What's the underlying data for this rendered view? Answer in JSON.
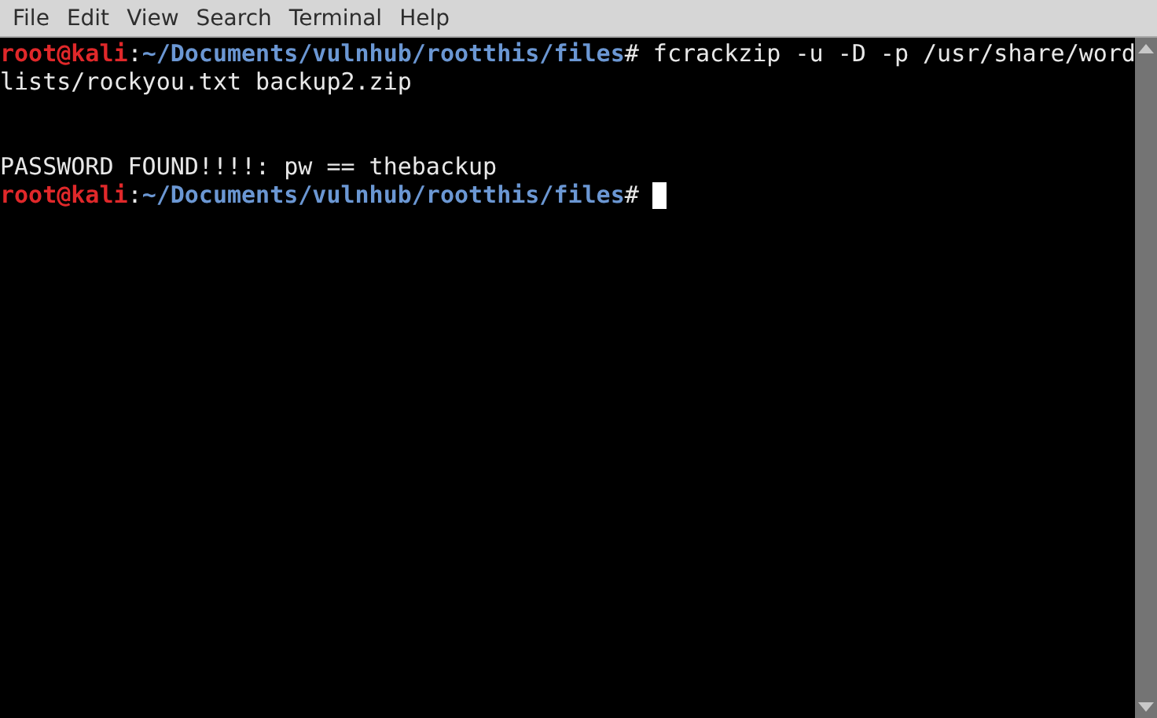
{
  "menu_bar": {
    "items": [
      "File",
      "Edit",
      "View",
      "Search",
      "Terminal",
      "Help"
    ]
  },
  "terminal": {
    "lines": [
      {
        "kind": "text",
        "segments": [
          {
            "kind": "user",
            "text": "root@kali"
          },
          {
            "kind": "plain",
            "text": ":"
          },
          {
            "kind": "path",
            "text": "~/Documents/vulnhub/rootthis/files"
          },
          {
            "kind": "plain",
            "text": "# fcrackzip -u -D -p /usr/share/word"
          }
        ]
      },
      {
        "kind": "text",
        "segments": [
          {
            "kind": "plain",
            "text": "lists/rockyou.txt backup2.zip"
          }
        ]
      },
      {
        "kind": "blank"
      },
      {
        "kind": "blank"
      },
      {
        "kind": "text",
        "segments": [
          {
            "kind": "plain",
            "text": "PASSWORD FOUND!!!!: pw == thebackup"
          }
        ]
      },
      {
        "kind": "text",
        "cursor": true,
        "segments": [
          {
            "kind": "user",
            "text": "root@kali"
          },
          {
            "kind": "plain",
            "text": ":"
          },
          {
            "kind": "path",
            "text": "~/Documents/vulnhub/rootthis/files"
          },
          {
            "kind": "plain",
            "text": "# "
          }
        ]
      }
    ]
  }
}
